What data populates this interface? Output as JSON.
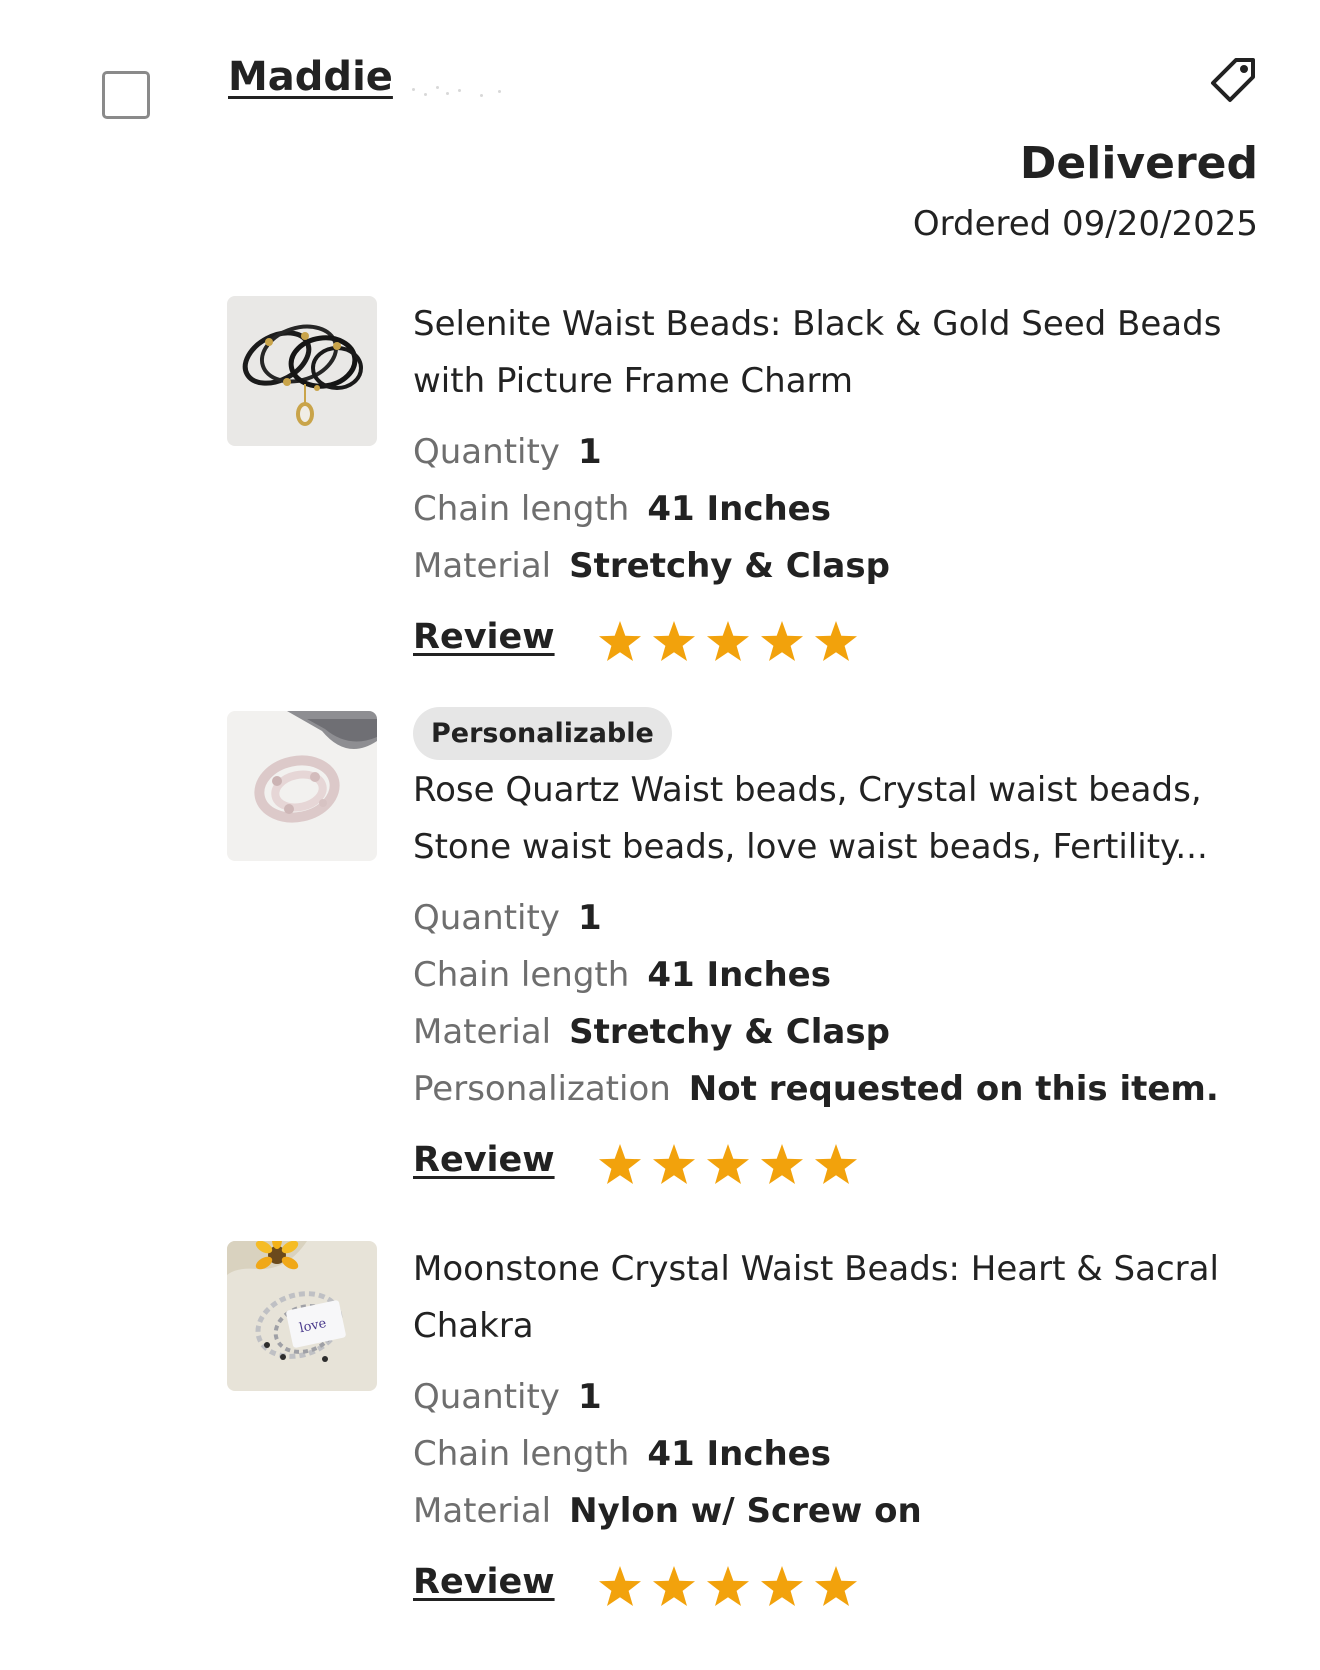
{
  "order": {
    "buyer_name": "Maddie",
    "status": "Delivered",
    "ordered_text": "Ordered 09/20/2025"
  },
  "colors": {
    "star": "#F2A20C",
    "text": "#222222",
    "muted": "#6E6E6E",
    "pill_bg": "#E6E6E6"
  },
  "items": [
    {
      "title_line1": "Selenite Waist Beads: Black & Gold Seed Beads",
      "title_line2": "with Picture Frame Charm",
      "attributes": [
        {
          "label": "Quantity",
          "value": "1"
        },
        {
          "label": "Chain length",
          "value": "41 Inches"
        },
        {
          "label": "Material",
          "value": "Stretchy & Clasp"
        }
      ],
      "review_label": "Review",
      "rating": 5
    },
    {
      "badge": "Personalizable",
      "title_line1": "Rose Quartz Waist beads, Crystal waist beads,",
      "title_line2": "Stone waist beads, love waist beads, Fertility...",
      "attributes": [
        {
          "label": "Quantity",
          "value": "1"
        },
        {
          "label": "Chain length",
          "value": "41 Inches"
        },
        {
          "label": "Material",
          "value": "Stretchy & Clasp"
        },
        {
          "label": "Personalization",
          "value": "Not requested on this item."
        }
      ],
      "review_label": "Review",
      "rating": 5
    },
    {
      "title_line1": "Moonstone Crystal Waist Beads: Heart & Sacral",
      "title_line2": "Chakra",
      "attributes": [
        {
          "label": "Quantity",
          "value": "1"
        },
        {
          "label": "Chain length",
          "value": "41 Inches"
        },
        {
          "label": "Material",
          "value": "Nylon w/ Screw on"
        }
      ],
      "review_label": "Review",
      "rating": 5
    }
  ]
}
